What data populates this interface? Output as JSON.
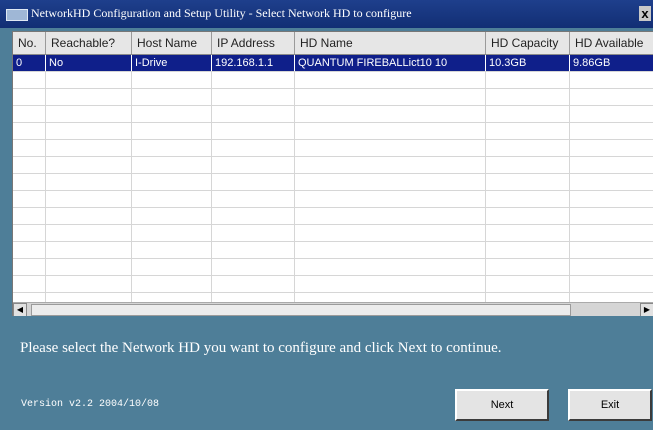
{
  "window": {
    "title": "NetworkHD Configuration and Setup Utility - Select Network HD to configure",
    "close_label": "x"
  },
  "table": {
    "columns": [
      "No.",
      "Reachable?",
      "Host Name",
      "IP Address",
      "HD Name",
      "HD Capacity",
      "HD Available"
    ],
    "rows": [
      [
        "0",
        "No",
        "I-Drive",
        "192.168.1.1",
        "QUANTUM FIREBALLict10 10",
        "10.3GB",
        "9.86GB"
      ]
    ],
    "selected_row": 0,
    "empty_row_count": 14
  },
  "message": "Please select the Network HD you want to configure and click Next to continue.",
  "version": "Version v2.2  2004/10/08",
  "buttons": {
    "next": "Next",
    "exit": "Exit"
  },
  "colors": {
    "dialog_bg": "#4e7e98",
    "titlebar": "#1e3f8c",
    "selection": "#0f1f8a"
  }
}
